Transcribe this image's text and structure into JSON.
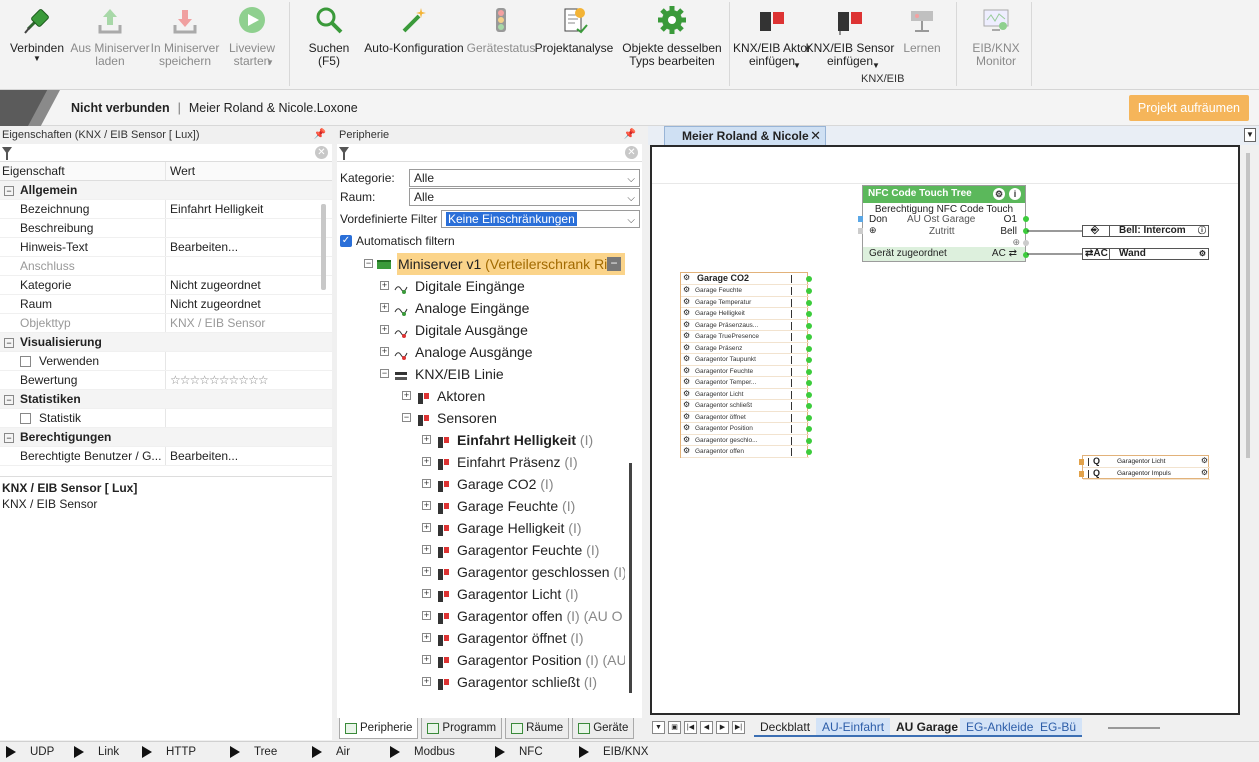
{
  "ribbon": {
    "buttons": [
      {
        "label": "Verbinden",
        "dropdown": true,
        "icon": "plug-icon",
        "enabled": true
      },
      {
        "label": "Aus Miniserver\nladen",
        "icon": "upload-icon",
        "enabled": false
      },
      {
        "label": "In Miniserver\nspeichern",
        "icon": "download-icon",
        "enabled": false
      },
      {
        "label": "Liveview\nstarten",
        "dropdown": true,
        "icon": "play-icon",
        "enabled": false
      },
      {
        "label": "Suchen\n(F5)",
        "icon": "magnifier-icon",
        "enabled": true
      },
      {
        "label": "Auto-Konfiguration",
        "icon": "magic-wand-icon",
        "enabled": true
      },
      {
        "label": "Gerätestatus",
        "icon": "traffic-light-icon",
        "enabled": false
      },
      {
        "label": "Projektanalyse",
        "icon": "report-icon",
        "enabled": true
      },
      {
        "label": "Objekte desselben\nTyps bearbeiten",
        "icon": "gear-icon",
        "enabled": true
      },
      {
        "label": "KNX/EIB Aktor\neinfügen",
        "dropdown": true,
        "icon": "knx-actor-icon",
        "enabled": true
      },
      {
        "label": "KNX/EIB Sensor\neinfügen",
        "dropdown": true,
        "icon": "knx-sensor-icon",
        "enabled": true
      },
      {
        "label": "Lernen",
        "icon": "learn-icon",
        "enabled": false
      },
      {
        "label": "EIB/KNX\nMonitor",
        "icon": "monitor-icon",
        "enabled": false
      }
    ],
    "group_label": "KNX/EIB"
  },
  "status": {
    "connection": "Nicht verbunden",
    "separator": "|",
    "project": "Meier Roland & Nicole.Loxone",
    "cleanup_button": "Projekt aufräumen"
  },
  "properties": {
    "title": "Eigenschaften (KNX / EIB Sensor [ Lux])",
    "col_property": "Eigenschaft",
    "col_value": "Wert",
    "rows": [
      {
        "type": "cat",
        "k": "Allgemein"
      },
      {
        "k": "Bezeichnung",
        "v": "Einfahrt Helligkeit"
      },
      {
        "k": "Beschreibung",
        "v": ""
      },
      {
        "k": "Hinweis-Text",
        "v": "Bearbeiten..."
      },
      {
        "k": "Anschluss",
        "v": "",
        "dis": true
      },
      {
        "k": "Kategorie",
        "v": "Nicht zugeordnet"
      },
      {
        "k": "Raum",
        "v": "Nicht zugeordnet"
      },
      {
        "k": "Objekttyp",
        "v": "KNX / EIB Sensor",
        "dis": true
      },
      {
        "type": "cat",
        "k": "Visualisierung"
      },
      {
        "k": "Verwenden",
        "v": "",
        "check": true
      },
      {
        "k": "Bewertung",
        "v": "☆☆☆☆☆☆☆☆☆☆",
        "stars": true
      },
      {
        "type": "cat",
        "k": "Statistiken"
      },
      {
        "k": "Statistik",
        "v": "",
        "check": true
      },
      {
        "type": "cat",
        "k": "Berechtigungen"
      },
      {
        "k": "Berechtigte Benutzer / G...",
        "v": "Bearbeiten..."
      }
    ],
    "desc_title": "KNX / EIB Sensor [ Lux]",
    "desc_text": "KNX / EIB Sensor"
  },
  "peripherie": {
    "title": "Peripherie",
    "kategorie_label": "Kategorie:",
    "kategorie_value": "Alle",
    "raum_label": "Raum:",
    "raum_value": "Alle",
    "filter_label": "Vordefinierte Filter",
    "filter_value": "Keine Einschränkungen",
    "auto_filter": "Automatisch filtern",
    "tree": [
      {
        "level": 0,
        "label": "Miniserver v1",
        "suffix": " (Verteilerschrank Ri",
        "icon": "miniserver-icon",
        "ms": true,
        "open": true
      },
      {
        "level": 1,
        "label": "Digitale Eingänge",
        "icon": "digital-input-icon"
      },
      {
        "level": 1,
        "label": "Analoge Eingänge",
        "icon": "analog-input-icon"
      },
      {
        "level": 1,
        "label": "Digitale Ausgänge",
        "icon": "digital-output-icon"
      },
      {
        "level": 1,
        "label": "Analoge Ausgänge",
        "icon": "analog-output-icon"
      },
      {
        "level": 1,
        "label": "KNX/EIB Linie",
        "icon": "knx-line-icon",
        "open": true
      },
      {
        "level": 2,
        "label": "Aktoren",
        "icon": "knx-actor-icon"
      },
      {
        "level": 2,
        "label": "Sensoren",
        "icon": "knx-sensor-icon",
        "open": true
      },
      {
        "level": 3,
        "label": "Einfahrt Helligkeit",
        "suffix": " (I)",
        "icon": "knx-sensor-icon",
        "sel": true
      },
      {
        "level": 3,
        "label": "Einfahrt Präsenz",
        "suffix": " (I)",
        "icon": "knx-sensor-icon"
      },
      {
        "level": 3,
        "label": "Garage CO2",
        "suffix": " (I)",
        "icon": "knx-sensor-icon"
      },
      {
        "level": 3,
        "label": "Garage Feuchte",
        "suffix": " (I)",
        "icon": "knx-sensor-icon"
      },
      {
        "level": 3,
        "label": "Garage Helligkeit",
        "suffix": " (I)",
        "icon": "knx-sensor-icon"
      },
      {
        "level": 3,
        "label": "Garagentor Feuchte",
        "suffix": " (I)",
        "icon": "knx-sensor-icon"
      },
      {
        "level": 3,
        "label": "Garagentor geschlossen",
        "suffix": " (I)",
        "icon": "knx-sensor-icon"
      },
      {
        "level": 3,
        "label": "Garagentor Licht",
        "suffix": " (I)",
        "icon": "knx-sensor-icon"
      },
      {
        "level": 3,
        "label": "Garagentor offen",
        "suffix": " (I) (AU O",
        "icon": "knx-sensor-icon"
      },
      {
        "level": 3,
        "label": "Garagentor öffnet",
        "suffix": " (I)",
        "icon": "knx-sensor-icon"
      },
      {
        "level": 3,
        "label": "Garagentor Position",
        "suffix": " (I) (AU",
        "icon": "knx-sensor-icon"
      },
      {
        "level": 3,
        "label": "Garagentor schließt",
        "suffix": " (I)",
        "icon": "knx-sensor-icon"
      }
    ],
    "tabs": [
      "Peripherie",
      "Programm",
      "Räume",
      "Geräte"
    ]
  },
  "canvas": {
    "tab_title": "Meier Roland & Nicole",
    "nfc": {
      "title": "NFC Code Touch Tree",
      "sub": "Berechtigung NFC Code Touch",
      "don": "Don",
      "room": "AU Ost Garage",
      "o1": "O1",
      "zutritt": "Zutritt",
      "bell": "Bell",
      "footer": "Gerät zugeordnet",
      "ac": "AC"
    },
    "ref_bell": "Bell: Intercom",
    "ref_wand_tag": "AC",
    "ref_wand": "Wand",
    "garage_block": {
      "title": "Garage CO2",
      "rows": [
        "Garage Feuchte",
        "Garage Temperatur",
        "Garage Helligkeit",
        "Garage Präsenzaus...",
        "Garage TruePresence",
        "Garage Präsenz",
        "Garagentor Taupunkt",
        "Garagentor Feuchte",
        "Garagentor Temper...",
        "Garagentor Licht",
        "Garagentor schließt",
        "Garagentor öffnet",
        "Garagentor Position",
        "Garagentor geschlo...",
        "Garagentor offen"
      ]
    },
    "q_block": [
      {
        "q": "Q",
        "label": "Garagentor Licht"
      },
      {
        "q": "Q",
        "label": "Garagentor Impuls"
      }
    ],
    "sheets": [
      "Deckblatt",
      "AU-Einfahrt",
      "AU Garage",
      "EG-Ankleide",
      "EG-Bü"
    ],
    "current_sheet": "AU Garage"
  },
  "bottom": [
    "UDP",
    "Link",
    "HTTP",
    "Tree",
    "Air",
    "Modbus",
    "NFC",
    "EIB/KNX"
  ]
}
